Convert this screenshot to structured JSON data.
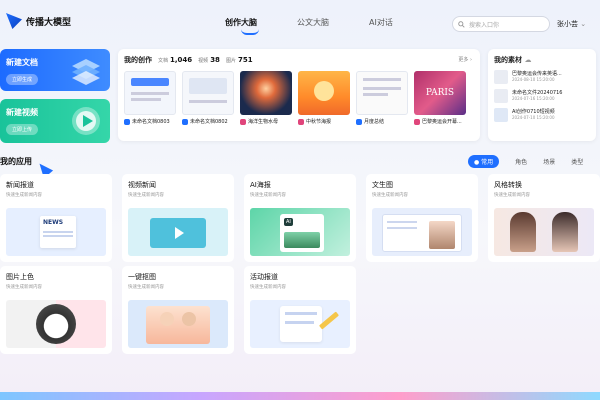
{
  "header": {
    "logo_title": "传播大模型",
    "nav": [
      "创作大脑",
      "公文大脑",
      "AI对话"
    ],
    "search_placeholder": "搜索入口你",
    "user": "张小芸"
  },
  "left_cards": [
    {
      "title": "新建文档",
      "button": "立即生成"
    },
    {
      "title": "新建视频",
      "button": "立即上传"
    }
  ],
  "my_creations": {
    "title": "我的创作",
    "stats": [
      {
        "label": "文档",
        "value": "1,046"
      },
      {
        "label": "视频",
        "value": "38"
      },
      {
        "label": "图片",
        "value": "751"
      }
    ],
    "more": "更多",
    "items": [
      {
        "caption": "未命名文档0803"
      },
      {
        "caption": "未命名文档0802"
      },
      {
        "caption": "海洋生物水母"
      },
      {
        "caption": "中秋节海报"
      },
      {
        "caption": "月度总结"
      },
      {
        "caption": "巴黎奥运会开幕..."
      }
    ]
  },
  "my_assets": {
    "title": "我的素材",
    "items": [
      {
        "name": "巴黎奥运会传来英语...",
        "date": "2024-08-10 15:20:00"
      },
      {
        "name": "未命名文件20240716",
        "date": "2024-07-16 15:20:00"
      },
      {
        "name": "AI创作0710短视频",
        "date": "2024-07-10 15:20:00"
      }
    ]
  },
  "apps_section": {
    "title": "我的应用",
    "filters": [
      "常用",
      "角色",
      "场景",
      "类型"
    ]
  },
  "apps": [
    {
      "name": "新闻报道",
      "desc": "快速生成新闻内容",
      "badge": "NEWS"
    },
    {
      "name": "视频新闻",
      "desc": "快速生成新闻内容"
    },
    {
      "name": "AI海报",
      "desc": "快速生成新闻内容",
      "badge": "AI"
    },
    {
      "name": "文生图",
      "desc": "快速生成新闻内容"
    },
    {
      "name": "风格转换",
      "desc": "快速生成新闻内容"
    },
    {
      "name": "图片上色",
      "desc": "快速生成新闻内容"
    },
    {
      "name": "一键抠图",
      "desc": "快速生成新闻内容"
    },
    {
      "name": "活动报道",
      "desc": "快速生成新闻内容"
    }
  ],
  "colors": {
    "accent": "#1f6fff",
    "green": "#19c39a"
  }
}
